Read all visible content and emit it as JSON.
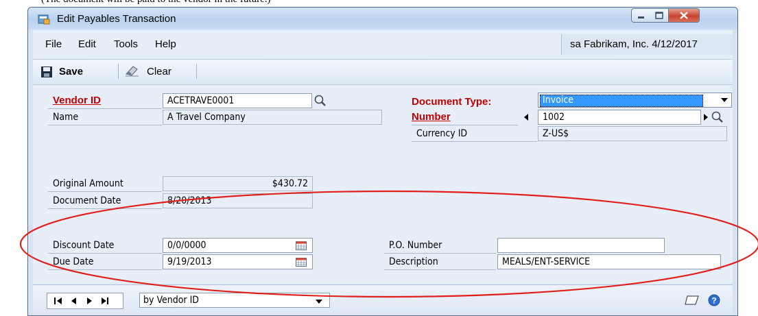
{
  "caption_top": "(The document will be paid to the vendor in the future.)",
  "window": {
    "title": "Edit Payables Transaction",
    "controls": [
      "minimize-icon",
      "maximize-icon",
      "close-icon"
    ]
  },
  "menu": {
    "items": [
      "File",
      "Edit",
      "Tools",
      "Help"
    ],
    "user_info": "sa  Fabrikam, Inc.  4/12/2017"
  },
  "toolbar": {
    "save_label": "Save",
    "clear_label": "Clear"
  },
  "form": {
    "vendor_id": {
      "label": "Vendor ID",
      "value": "ACETRAVE0001"
    },
    "name": {
      "label": "Name",
      "value": "A Travel Company"
    },
    "document_type": {
      "label": "Document Type:",
      "value": "Invoice"
    },
    "number": {
      "label": "Number",
      "value": "1002"
    },
    "currency_id": {
      "label": "Currency ID",
      "value": "Z-US$"
    },
    "original_amount": {
      "label": "Original Amount",
      "value": "$430.72"
    },
    "document_date": {
      "label": "Document Date",
      "value": "8/20/2013"
    },
    "discount_date": {
      "label": "Discount Date",
      "value": "0/0/0000"
    },
    "due_date": {
      "label": "Due Date",
      "value": "9/19/2013"
    },
    "po_number": {
      "label": "P.O. Number",
      "value": ""
    },
    "description": {
      "label": "Description",
      "value": "MEALS/ENT-SERVICE"
    }
  },
  "bottom": {
    "sort_by": "by Vendor ID",
    "nav": [
      "first-record-icon",
      "previous-record-icon",
      "next-record-icon",
      "last-record-icon"
    ]
  },
  "colors": {
    "required_label": "#c00000",
    "selected_highlight": "#3399ff",
    "annotation": "#e0201c"
  }
}
